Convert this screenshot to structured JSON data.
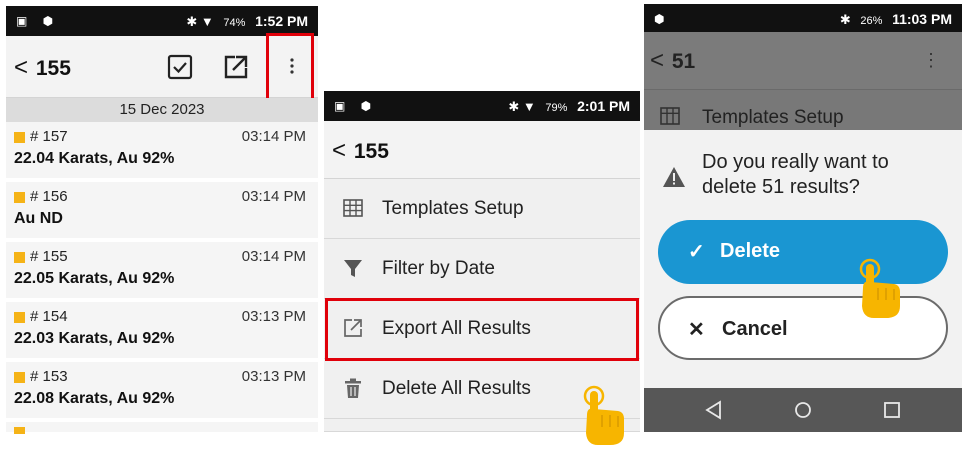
{
  "panel1": {
    "status": {
      "time": "1:52 PM",
      "battery": "74%"
    },
    "back_label": "155",
    "date_header": "15 Dec 2023",
    "results": [
      {
        "number": "# 157",
        "time": "03:14 PM",
        "value": "22.04 Karats, Au 92%"
      },
      {
        "number": "# 156",
        "time": "03:14 PM",
        "value": "Au ND"
      },
      {
        "number": "# 155",
        "time": "03:14 PM",
        "value": "22.05 Karats, Au 92%"
      },
      {
        "number": "# 154",
        "time": "03:13 PM",
        "value": "22.03 Karats, Au 92%"
      },
      {
        "number": "# 153",
        "time": "03:13 PM",
        "value": "22.08 Karats, Au 92%"
      }
    ]
  },
  "panel2": {
    "status": {
      "time": "2:01 PM",
      "battery": "79%"
    },
    "back_label": "155",
    "menu": [
      {
        "label": "Templates Setup",
        "icon": "grid-icon"
      },
      {
        "label": "Filter by Date",
        "icon": "filter-icon"
      },
      {
        "label": "Export All Results",
        "icon": "export-icon"
      },
      {
        "label": "Delete All Results",
        "icon": "trash-icon"
      }
    ]
  },
  "panel3": {
    "status": {
      "time": "11:03 PM",
      "battery": "26%"
    },
    "back_label": "51",
    "background_item": "Templates Setup",
    "dialog": {
      "message_line1": "Do you really want to",
      "message_line2": "delete 51 results?",
      "delete_label": "Delete",
      "cancel_label": "Cancel"
    }
  },
  "colors": {
    "highlight": "#e0000a",
    "result_marker": "#f5b317",
    "delete_button": "#1a96d2",
    "hand": "#f7b500"
  }
}
